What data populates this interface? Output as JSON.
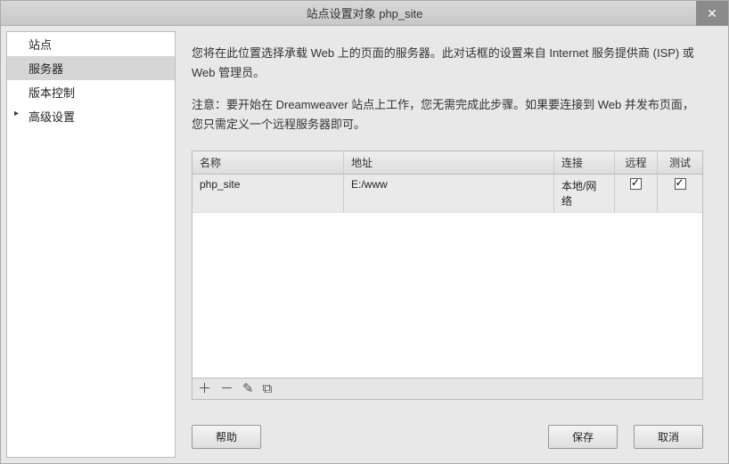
{
  "title": "站点设置对象 php_site",
  "sidebar": {
    "items": [
      {
        "label": "站点"
      },
      {
        "label": "服务器"
      },
      {
        "label": "版本控制"
      },
      {
        "label": "高级设置"
      }
    ]
  },
  "main": {
    "intro1": "您将在此位置选择承载 Web 上的页面的服务器。此对话框的设置来自 Internet 服务提供商 (ISP) 或 Web 管理员。",
    "intro2": "注意：要开始在 Dreamweaver 站点上工作，您无需完成此步骤。如果要连接到 Web 并发布页面，您只需定义一个远程服务器即可。"
  },
  "table": {
    "headers": {
      "name": "名称",
      "address": "地址",
      "connection": "连接",
      "remote": "远程",
      "test": "测试"
    },
    "rows": [
      {
        "name": "php_site",
        "address": "E:/www",
        "connection": "本地/网络",
        "remote": true,
        "test": true
      }
    ]
  },
  "toolbar": {
    "add": "＋",
    "remove": "－",
    "edit": "✎",
    "duplicate": "⧉"
  },
  "buttons": {
    "help": "帮助",
    "save": "保存",
    "cancel": "取消"
  }
}
